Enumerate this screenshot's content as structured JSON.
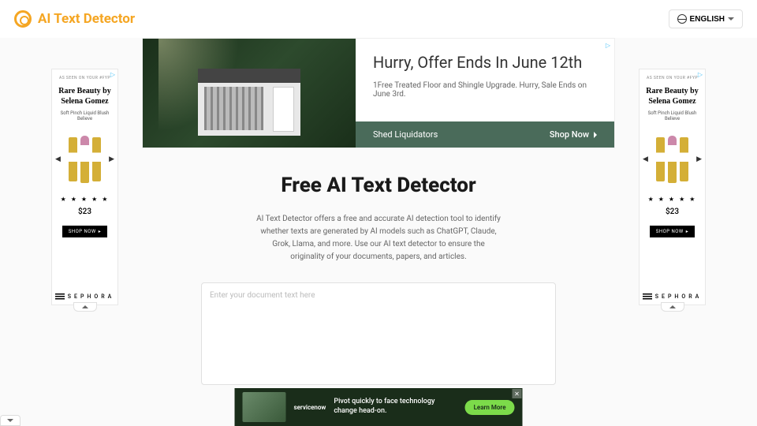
{
  "header": {
    "brand": "AI Text Detector",
    "lang": "ENGLISH"
  },
  "top_ad": {
    "headline": "Hurry, Offer Ends In June 12th",
    "sub": "1Free Treated Floor and Shingle Upgrade. Hurry, Sale Ends on June 3rd.",
    "brand": "Shed Liquidators",
    "cta": "Shop Now"
  },
  "hero": {
    "title": "Free AI Text Detector",
    "desc": "AI Text Detector offers a free and accurate AI detection tool to identify whether texts are generated by AI models such as ChatGPT, Claude, Grok, Llama, and more. Use our AI text detector to ensure the originality of your documents, papers, and articles."
  },
  "textarea": {
    "placeholder": "Enter your document text here"
  },
  "side_ad": {
    "tag": "AS SEEN ON YOUR #FYP",
    "title": "Rare Beauty by Selena Gomez",
    "sub": "Soft Pinch Liquid Blush Believe",
    "stars": "★ ★ ★ ★ ★",
    "price": "$23",
    "cta": "SHOP NOW",
    "store": "SEPHORA"
  },
  "bottom_ad": {
    "logo": "servicenow",
    "text": "Pivot quickly to face technology change head-on.",
    "cta": "Learn More"
  }
}
